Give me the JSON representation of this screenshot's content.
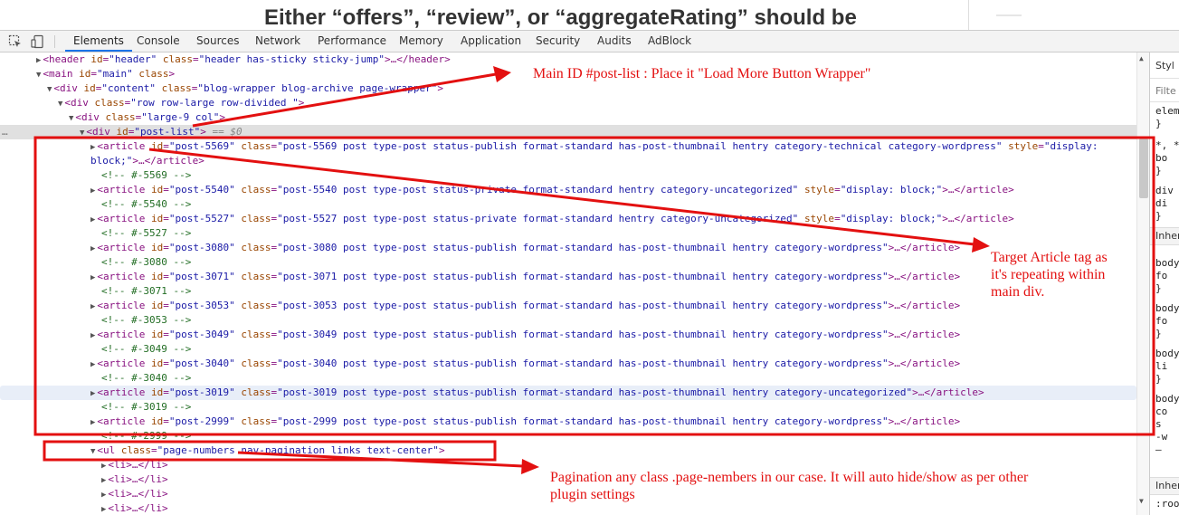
{
  "page": {
    "title": "Either “offers”, “review”, or “aggregateRating” should be"
  },
  "toolbar": {
    "tabs": [
      {
        "label": "Elements"
      },
      {
        "label": "Console"
      },
      {
        "label": "Sources"
      },
      {
        "label": "Network"
      },
      {
        "label": "Performance"
      },
      {
        "label": "Memory"
      },
      {
        "label": "Application"
      },
      {
        "label": "Security"
      },
      {
        "label": "Audits"
      },
      {
        "label": "AdBlock"
      }
    ],
    "active_tab": "Elements",
    "icons": [
      "inspect-element-icon",
      "device-toolbar-icon"
    ]
  },
  "dom": {
    "header": {
      "open": "<header",
      "a1": "id",
      "v1": "\"header\"",
      "a2": "class",
      "v2": "\"header has-sticky sticky-jump\"",
      "close": ">…</header>"
    },
    "main": {
      "open": "<main",
      "a1": "id",
      "v1": "\"main\"",
      "a2": "class",
      "close": ">"
    },
    "content": {
      "open": "<div",
      "a1": "id",
      "v1": "\"content\"",
      "a2": "class",
      "v2": "\"blog-wrapper blog-archive page-wrapper\"",
      "close": ">"
    },
    "row": {
      "open": "<div",
      "a1": "class",
      "v1": "\"row row-large row-divided \"",
      "close": ">"
    },
    "col": {
      "open": "<div",
      "a1": "class",
      "v1": "\"large-9 col\"",
      "close": ">"
    },
    "postlist": {
      "open": "<div",
      "a1": "id",
      "v1": "\"post-list\"",
      "close": ">",
      "marker": " == $0",
      "ellipsis": "…"
    },
    "first_article": {
      "open": "<article",
      "a1": "id",
      "v1": "\"post-5569\"",
      "a2": "class",
      "v2": "\"post-5569 post type-post status-publish format-standard has-post-thumbnail hentry category-technical category-wordpress\"",
      "a3": "style",
      "v3a": "\"display:",
      "v3b": "block;\"",
      "close": ">…</article>"
    },
    "rows": [
      {
        "kind": "comment",
        "text": "<!-- #-5569 -->"
      },
      {
        "kind": "article",
        "open": "<article",
        "a1": "id",
        "v1": "\"post-5540\"",
        "a2": "class",
        "v2": "\"post-5540 post type-post status-private format-standard hentry category-uncategorized\"",
        "a3": "style",
        "v3": "\"display: block;\"",
        "close": ">…</article>"
      },
      {
        "kind": "comment",
        "text": "<!-- #-5540 -->"
      },
      {
        "kind": "article",
        "open": "<article",
        "a1": "id",
        "v1": "\"post-5527\"",
        "a2": "class",
        "v2": "\"post-5527 post type-post status-private format-standard hentry category-uncategorized\"",
        "a3": "style",
        "v3": "\"display: block;\"",
        "close": ">…</article>"
      },
      {
        "kind": "comment",
        "text": "<!-- #-5527 -->"
      },
      {
        "kind": "article",
        "open": "<article",
        "a1": "id",
        "v1": "\"post-3080\"",
        "a2": "class",
        "v2": "\"post-3080 post type-post status-publish format-standard has-post-thumbnail hentry category-wordpress\"",
        "close": ">…</article>"
      },
      {
        "kind": "comment",
        "text": "<!-- #-3080 -->"
      },
      {
        "kind": "article",
        "open": "<article",
        "a1": "id",
        "v1": "\"post-3071\"",
        "a2": "class",
        "v2": "\"post-3071 post type-post status-publish format-standard has-post-thumbnail hentry category-wordpress\"",
        "close": ">…</article>"
      },
      {
        "kind": "comment",
        "text": "<!-- #-3071 -->"
      },
      {
        "kind": "article",
        "open": "<article",
        "a1": "id",
        "v1": "\"post-3053\"",
        "a2": "class",
        "v2": "\"post-3053 post type-post status-publish format-standard has-post-thumbnail hentry category-wordpress\"",
        "close": ">…</article>"
      },
      {
        "kind": "comment",
        "text": "<!-- #-3053 -->"
      },
      {
        "kind": "article",
        "open": "<article",
        "a1": "id",
        "v1": "\"post-3049\"",
        "a2": "class",
        "v2": "\"post-3049 post type-post status-publish format-standard has-post-thumbnail hentry category-wordpress\"",
        "close": ">…</article>"
      },
      {
        "kind": "comment",
        "text": "<!-- #-3049 -->"
      },
      {
        "kind": "article",
        "open": "<article",
        "a1": "id",
        "v1": "\"post-3040\"",
        "a2": "class",
        "v2": "\"post-3040 post type-post status-publish format-standard has-post-thumbnail hentry category-wordpress\"",
        "close": ">…</article>"
      },
      {
        "kind": "comment",
        "text": "<!-- #-3040 -->"
      },
      {
        "kind": "article",
        "hover": true,
        "open": "<article",
        "a1": "id",
        "v1": "\"post-3019\"",
        "a2": "class",
        "v2": "\"post-3019 post type-post status-publish format-standard has-post-thumbnail hentry category-uncategorized\"",
        "close": ">…</article>"
      },
      {
        "kind": "comment",
        "text": "<!-- #-3019 -->"
      },
      {
        "kind": "article",
        "open": "<article",
        "a1": "id",
        "v1": "\"post-2999\"",
        "a2": "class",
        "v2": "\"post-2999 post type-post status-publish format-standard has-post-thumbnail hentry category-wordpress\"",
        "close": ">…</article>"
      },
      {
        "kind": "comment",
        "text": "<!-- #-2999 -->"
      }
    ],
    "ul": {
      "open": "<ul",
      "a1": "class",
      "v1": "\"page-numbers nav-pagination links text-center\"",
      "close": ">"
    },
    "li_items": [
      "<li>…</li>",
      "<li>…</li>",
      "<li>…</li>",
      "<li>…</li>"
    ]
  },
  "styles_panel": {
    "tab_label": "Styl",
    "filter_placeholder": "Filte",
    "lines": [
      "eleme",
      "}",
      "*, *",
      "bo",
      "}",
      "div",
      "di",
      "}",
      "Inher",
      "body",
      "fo",
      "}",
      "body",
      "fo",
      "}",
      "body",
      "li",
      "}",
      "body",
      "co",
      "s",
      "-w",
      "—",
      "Inher",
      ":roo"
    ]
  },
  "annotations": {
    "post_list_note": "Main ID #post-list : Place it \"Load More Button Wrapper\"",
    "article_note": [
      "Target Article tag as",
      "it's repeating within",
      "main div."
    ],
    "pagination_note": [
      "Pagination any class .page-nembers in our case. It will auto hide/show as per other",
      "plugin settings"
    ],
    "color": "#e31010"
  }
}
